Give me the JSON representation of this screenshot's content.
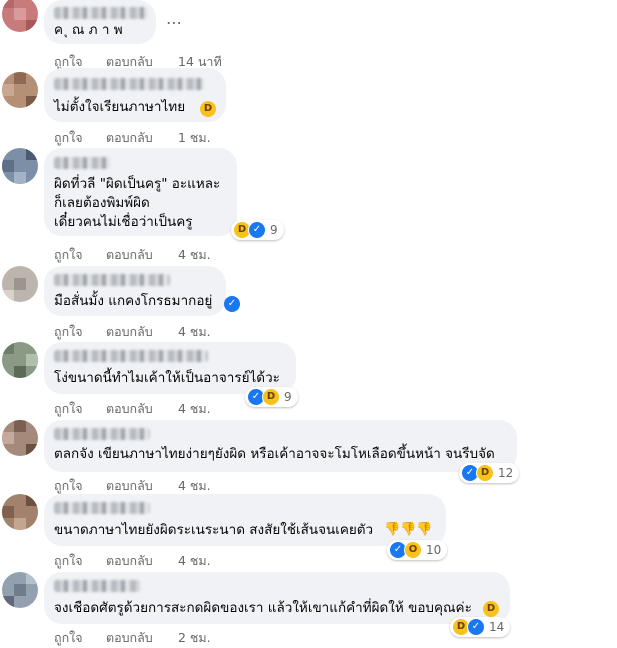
{
  "comments": [
    {
      "text": "ค ุ ณ ภ า พ",
      "like": "ถูกใจ",
      "reply": "ตอบกลับ",
      "time": "14 นาที"
    },
    {
      "text": "ไม่ตั้งใจเรียนภาษาไทย",
      "like": "ถูกใจ",
      "reply": "ตอบกลับ",
      "time": "1 ชม."
    },
    {
      "text": "ผิดที่วลี \"ผิดเป็นครู\" อะแหละ\nก็เลยต้องพิมพ์ผิด\nเดี๋ยวคนไม่เชื่อว่าเป็นครู",
      "like": "ถูกใจ",
      "reply": "ตอบกลับ",
      "time": "4 ชม.",
      "reaction_count": "9"
    },
    {
      "text": "มือสั่นมั้ง แกคงโกรธมากอยู่",
      "like": "ถูกใจ",
      "reply": "ตอบกลับ",
      "time": "4 ชม."
    },
    {
      "text": "โง่ขนาดนี้ทำไมเค้าให้เป็นอาจารย์ได้วะ",
      "like": "ถูกใจ",
      "reply": "ตอบกลับ",
      "time": "4 ชม.",
      "reaction_count": "9"
    },
    {
      "text": "ตลกจัง เขียนภาษาไทยง่ายๆยังผิด หรือเค้าอาจจะโมโหเลือดขึ้นหน้า จนรีบจัด",
      "like": "ถูกใจ",
      "reply": "ตอบกลับ",
      "time": "4 ชม.",
      "reaction_count": "12"
    },
    {
      "text": "ขนาดภาษาไทยยังผิดระเนระนาด สงสัยใช้เส้นจนเคยตัว",
      "like": "ถูกใจ",
      "reply": "ตอบกลับ",
      "time": "4 ชม.",
      "reaction_count": "10"
    },
    {
      "text": "จงเชือดศัตรูด้วยการสะกดผิดของเรา แล้วให้เขาแก้คำที่ผิดให้ ขอบคุณค่ะ",
      "like": "ถูกใจ",
      "reply": "ตอบกลับ",
      "time": "2 ชม.",
      "reaction_count": "14"
    }
  ],
  "more_icon": "⋯",
  "icons": {
    "like": "like-icon",
    "haha": "haha-icon",
    "wow": "wow-icon",
    "thumbs_down": "thumbs-down-emoji"
  },
  "colors": {
    "bubble": "#f0f2f5",
    "meta": "#65676b",
    "like_blue": "#1877f2",
    "haha_yellow": "#f7c21b"
  }
}
